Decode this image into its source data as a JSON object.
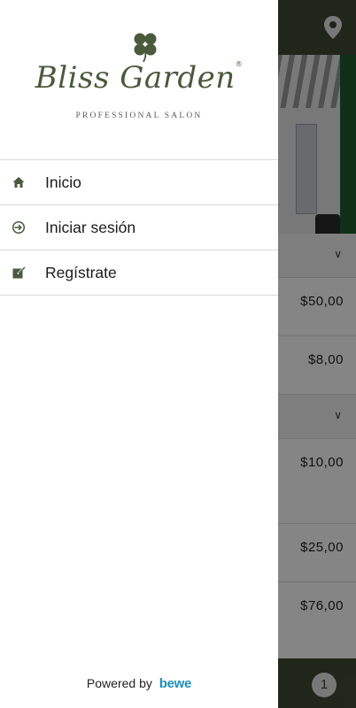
{
  "drawer": {
    "logo": {
      "brand": "Bliss Garden",
      "trademark": "®",
      "tagline": "PROFESSIONAL SALON",
      "icon": "clover-icon",
      "color": "#4a5a3c"
    },
    "menu": [
      {
        "label": "Inicio",
        "icon": "home-icon"
      },
      {
        "label": "Iniciar sesión",
        "icon": "sign-in-icon"
      },
      {
        "label": "Regístrate",
        "icon": "edit-register-icon"
      }
    ],
    "powered": {
      "text": "Powered by",
      "brand": "bewe",
      "brand_color": "#1f8fb6"
    }
  },
  "background": {
    "topbar": {
      "icon": "location-pin-icon",
      "color": "#3f4a33"
    },
    "prices": [
      "$50,00",
      "$8,00",
      "$10,00",
      "$25,00",
      "$76,00"
    ],
    "cart": {
      "count": "1"
    }
  }
}
